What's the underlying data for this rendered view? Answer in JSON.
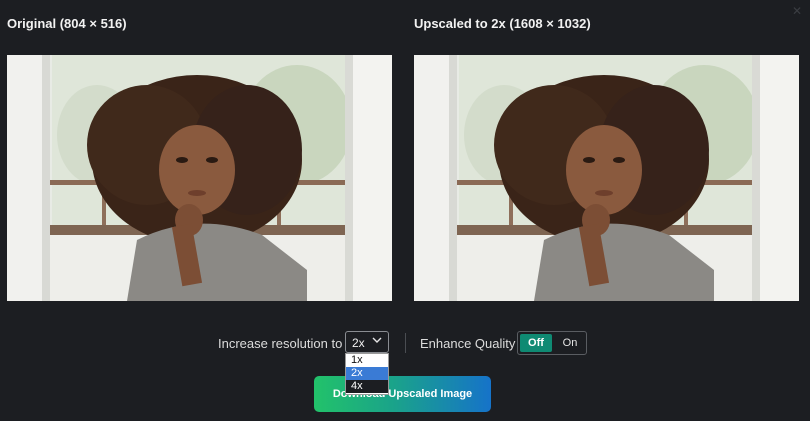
{
  "panels": {
    "left_title": "Original (804 × 516)",
    "right_title": "Upscaled to 2x (1608 × 1032)"
  },
  "controls": {
    "resolution_label": "Increase resolution to",
    "resolution_value": "2x",
    "resolution_options": [
      "1x",
      "2x",
      "4x"
    ],
    "enhance_label": "Enhance Quality",
    "toggle_off": "Off",
    "toggle_on": "On",
    "toggle_state": "Off"
  },
  "download": {
    "label": "Download Upscaled Image"
  },
  "icons": {
    "close": "close-icon",
    "chevron": "chevron-down-icon"
  },
  "colors": {
    "background": "#1c1e22",
    "toggle_active": "#0f8a73",
    "button_gradient_start": "#22c26a",
    "button_gradient_end": "#1673c9",
    "dropdown_selected": "#3a7bd5"
  }
}
